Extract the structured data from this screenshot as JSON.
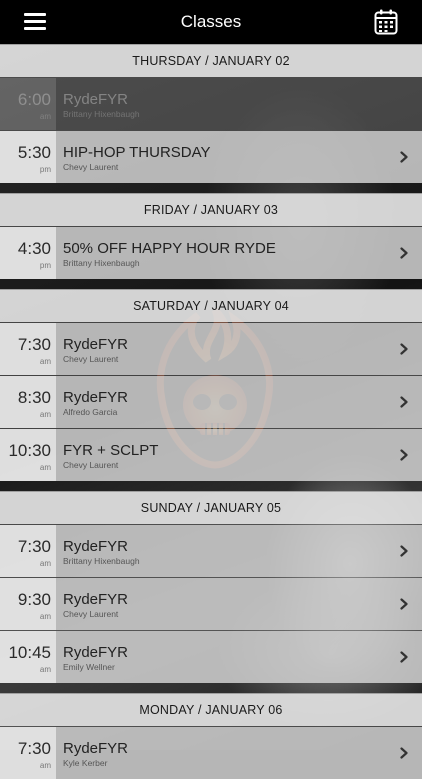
{
  "header": {
    "title": "Classes",
    "menu_icon": "hamburger-menu-icon",
    "calendar_icon": "calendar-icon"
  },
  "days": [
    {
      "label": "THURSDAY / JANUARY 02",
      "classes": [
        {
          "time": "6:00",
          "ampm": "am",
          "title": "RydeFYR",
          "instructor": "Brittany Hixenbaugh",
          "past": true
        },
        {
          "time": "5:30",
          "ampm": "pm",
          "title": "HIP-HOP THURSDAY",
          "instructor": "Chevy Laurent",
          "past": false
        }
      ]
    },
    {
      "label": "FRIDAY / JANUARY 03",
      "classes": [
        {
          "time": "4:30",
          "ampm": "pm",
          "title": "50% OFF HAPPY HOUR RYDE",
          "instructor": "Brittany Hixenbaugh",
          "past": false
        }
      ]
    },
    {
      "label": "SATURDAY / JANUARY 04",
      "classes": [
        {
          "time": "7:30",
          "ampm": "am",
          "title": "RydeFYR",
          "instructor": "Chevy Laurent",
          "past": false
        },
        {
          "time": "8:30",
          "ampm": "am",
          "title": "RydeFYR",
          "instructor": "Alfredo Garcia",
          "past": false
        },
        {
          "time": "10:30",
          "ampm": "am",
          "title": "FYR + SCLPT",
          "instructor": "Chevy Laurent",
          "past": false
        }
      ]
    },
    {
      "label": "SUNDAY / JANUARY 05",
      "classes": [
        {
          "time": "7:30",
          "ampm": "am",
          "title": "RydeFYR",
          "instructor": "Brittany Hixenbaugh",
          "past": false
        },
        {
          "time": "9:30",
          "ampm": "am",
          "title": "RydeFYR",
          "instructor": "Chevy Laurent",
          "past": false
        },
        {
          "time": "10:45",
          "ampm": "am",
          "title": "RydeFYR",
          "instructor": "Emily Wellner",
          "past": false
        }
      ]
    },
    {
      "label": "MONDAY / JANUARY 06",
      "classes": [
        {
          "time": "7:30",
          "ampm": "am",
          "title": "RydeFYR",
          "instructor": "Kyle Kerber",
          "past": false
        }
      ]
    }
  ],
  "colors": {
    "header_bg": "#000000",
    "logo_accent": "#f07a2a"
  }
}
